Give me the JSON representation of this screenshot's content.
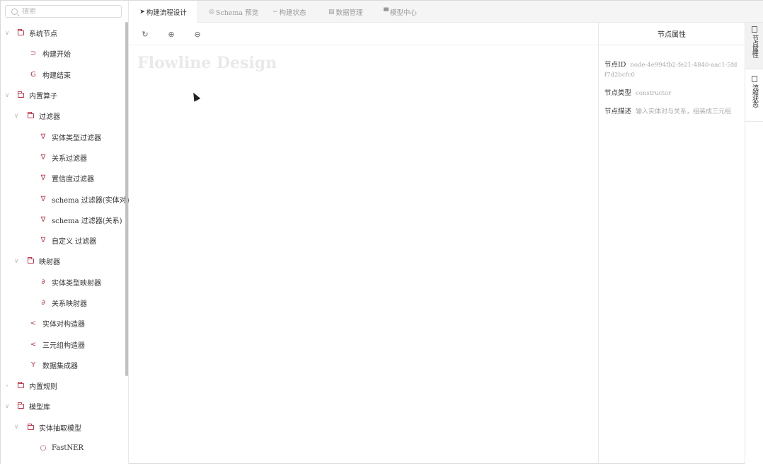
{
  "search": {
    "placeholder": "搜索"
  },
  "tree": [
    {
      "label": "系统节点",
      "icon": "folder-icon",
      "caret": "∨"
    },
    {
      "label": "构建开始",
      "icon": "start-icon",
      "glyph": "⊃"
    },
    {
      "label": "构建结束",
      "icon": "end-icon",
      "glyph": "G"
    },
    {
      "label": "内置算子",
      "icon": "folder-icon",
      "caret": "∨"
    },
    {
      "label": "过滤器",
      "icon": "folder-icon",
      "caret": "∨"
    },
    {
      "label": "实体类型过滤器",
      "icon": "filter-icon",
      "glyph": "∇"
    },
    {
      "label": "关系过滤器",
      "icon": "filter-icon",
      "glyph": "∇"
    },
    {
      "label": "置信度过滤器",
      "icon": "filter-icon",
      "glyph": "∇"
    },
    {
      "label": "schema 过滤器(实体对)",
      "icon": "filter-icon",
      "glyph": "∇"
    },
    {
      "label": "schema 过滤器(关系)",
      "icon": "filter-icon",
      "glyph": "∇"
    },
    {
      "label": "自定义 过滤器",
      "icon": "filter-icon",
      "glyph": "∇"
    },
    {
      "label": "映射器",
      "icon": "folder-icon",
      "caret": "∨"
    },
    {
      "label": "实体类型映射器",
      "icon": "link-icon",
      "glyph": "∂"
    },
    {
      "label": "关系映射器",
      "icon": "link-icon",
      "glyph": "∂"
    },
    {
      "label": "实体对构造器",
      "icon": "share-icon",
      "glyph": "<"
    },
    {
      "label": "三元组构造器",
      "icon": "share-icon",
      "glyph": "<"
    },
    {
      "label": "数据集成器",
      "icon": "merge-icon",
      "glyph": "Y"
    },
    {
      "label": "内置规则",
      "icon": "folder-icon",
      "caret": "›"
    },
    {
      "label": "模型库",
      "icon": "folder-icon",
      "caret": "∨"
    },
    {
      "label": "实体抽取模型",
      "icon": "folder-icon",
      "caret": "∨"
    },
    {
      "label": "FastNER",
      "icon": "model-icon",
      "glyph": "○"
    }
  ],
  "tabs": [
    {
      "label": "构建流程设计",
      "icon": "send-icon",
      "glyph": "➤"
    },
    {
      "label": "Schema 预览",
      "icon": "eye-icon",
      "glyph": "◎"
    },
    {
      "label": "构建状态",
      "icon": "status-icon",
      "glyph": "∽"
    },
    {
      "label": "数据管理",
      "icon": "table-icon",
      "glyph": "▤"
    },
    {
      "label": "模型中心",
      "icon": "model-center-icon",
      "glyph": "▀"
    }
  ],
  "toolbar": {
    "undo_glyph": "↻",
    "zoom_in_glyph": "⊕",
    "zoom_out_glyph": "⊖"
  },
  "canvas": {
    "watermark": "Flowline Design"
  },
  "props": {
    "header": "节点属性",
    "id_label": "节点ID",
    "id_value": "node-4e994fb2-fe21-4840-aac1-5fdf7d2bcfc0",
    "type_label": "节点类型",
    "type_value": "constructor",
    "desc_label": "节点描述",
    "desc_value": "输入实体对与关系，组装成三元组"
  },
  "rail": {
    "tab1": "节点属性",
    "tab2": "流程状态"
  },
  "colors": {
    "accent": "#c0394c",
    "border": "#e8e8e8",
    "muted": "#999999"
  }
}
